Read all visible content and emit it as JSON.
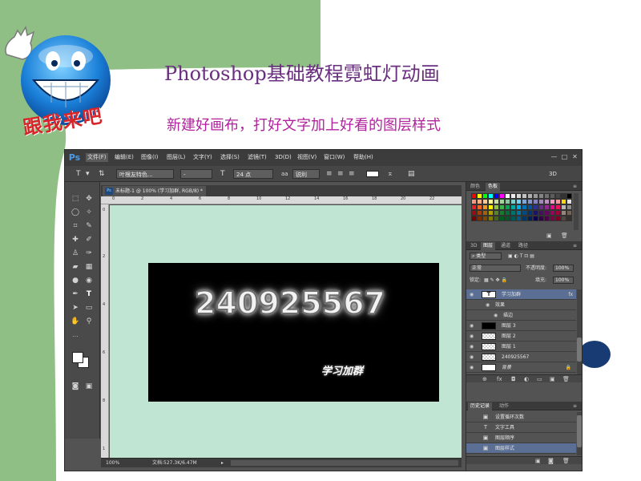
{
  "slide": {
    "title": "Photoshop基础教程霓虹灯动画",
    "subtitle": "新建好画布，打好文字加上好看的图层样式",
    "mascot_caption": "跟我来吧",
    "colors": {
      "green_bg": "#8fbf85",
      "title": "#6a2f7f",
      "subtitle": "#b0239c",
      "caption": "#d8252a",
      "accent_circle": "#183b73"
    }
  },
  "photoshop": {
    "logo": "Ps",
    "menu": [
      "文件(F)",
      "编辑(E)",
      "图像(I)",
      "图层(L)",
      "文字(Y)",
      "选择(S)",
      "滤镜(T)",
      "3D(D)",
      "视图(V)",
      "窗口(W)",
      "帮助(H)"
    ],
    "window_controls": [
      "—",
      "□",
      "✕"
    ],
    "options": {
      "tool_icon": "T",
      "font_family": "叶根友特色...",
      "font_style": "-",
      "size": "24 点",
      "antialias": "锐利",
      "workspace": "3D"
    },
    "document": {
      "tab": "未标题-1 @ 100% (学习加群, RGB/8) *",
      "tab_icon": "Ps",
      "ruler_top": [
        "0",
        "2",
        "4",
        "6",
        "8",
        "10",
        "12",
        "14",
        "16",
        "18",
        "20",
        "22"
      ],
      "ruler_left": [
        "0",
        "2",
        "4",
        "6",
        "8",
        "1"
      ],
      "neon_text": "240925567",
      "caption_text": "学习加群",
      "zoom": "100%",
      "doc_info": "文档:527.3K/6.47M"
    },
    "swatches_panel": {
      "tabs": [
        "颜色",
        "色板"
      ],
      "colors": [
        "#ff0000",
        "#ffff00",
        "#00ff00",
        "#00ffff",
        "#0000ff",
        "#ff00ff",
        "#ffffff",
        "#ebebeb",
        "#d6d6d6",
        "#c2c2c2",
        "#adadad",
        "#999999",
        "#858585",
        "#707070",
        "#5c5c5c",
        "#474747",
        "#333333",
        "#000000",
        "#f7977a",
        "#fbad82",
        "#fdc68c",
        "#fff79a",
        "#c4df9b",
        "#a3d39c",
        "#82ca9d",
        "#7bcdc8",
        "#6ecff6",
        "#7ea7d8",
        "#8493ca",
        "#8882be",
        "#a187be",
        "#bc8dbf",
        "#f49ac2",
        "#f6989d",
        "#ffd700",
        "#e0e0e0",
        "#ed1c24",
        "#f26522",
        "#f7941d",
        "#fff200",
        "#8dc73f",
        "#39b54a",
        "#00a651",
        "#00a99d",
        "#00aeef",
        "#0072bc",
        "#0054a6",
        "#2e3192",
        "#662d91",
        "#92278f",
        "#ec008c",
        "#ed145b",
        "#b7b7b7",
        "#8a8a8a",
        "#9e0b0f",
        "#a0410d",
        "#a36209",
        "#aba000",
        "#598527",
        "#1a7b30",
        "#007236",
        "#00746b",
        "#0076a3",
        "#004b80",
        "#003471",
        "#1b1464",
        "#440e62",
        "#630460",
        "#9e005d",
        "#9e0039",
        "#998675",
        "#736357",
        "#790000",
        "#7b2e00",
        "#7d4900",
        "#827b00",
        "#406618",
        "#005e20",
        "#005826",
        "#005952",
        "#005b7f",
        "#003663",
        "#002157",
        "#0d004c",
        "#32004b",
        "#4b0049",
        "#7b0046",
        "#7a0026",
        "#534741",
        "#362f2d"
      ]
    },
    "layers_panel": {
      "tabs": [
        "3D",
        "图层",
        "通道",
        "路径"
      ],
      "filter": "类型",
      "blend_mode": "正常",
      "opacity_label": "不透明度:",
      "opacity": "100%",
      "lock_label": "锁定:",
      "fill_label": "填充:",
      "fill": "100%",
      "layers": [
        {
          "name": "学习加群",
          "kind": "text",
          "fx": "fx",
          "selected": true
        },
        {
          "name": "效果",
          "kind": "effects"
        },
        {
          "name": "描边",
          "kind": "effect"
        },
        {
          "name": "图层 3",
          "kind": "black"
        },
        {
          "name": "图层 2",
          "kind": "trans"
        },
        {
          "name": "图层 1",
          "kind": "trans"
        },
        {
          "name": "240925567",
          "kind": "trans"
        },
        {
          "name": "背景",
          "kind": "white",
          "locked": true
        }
      ],
      "footer_icons": [
        "⊕",
        "fx",
        "◘",
        "◐",
        "▭",
        "▣",
        "🗑"
      ]
    },
    "history_panel": {
      "tabs": [
        "历史记录",
        "动作"
      ],
      "items": [
        {
          "icon": "▣",
          "label": "设置循环次数"
        },
        {
          "icon": "T",
          "label": "文字工具"
        },
        {
          "icon": "▣",
          "label": "图层顺序"
        },
        {
          "icon": "▣",
          "label": "图层样式",
          "selected": true
        }
      ]
    }
  }
}
